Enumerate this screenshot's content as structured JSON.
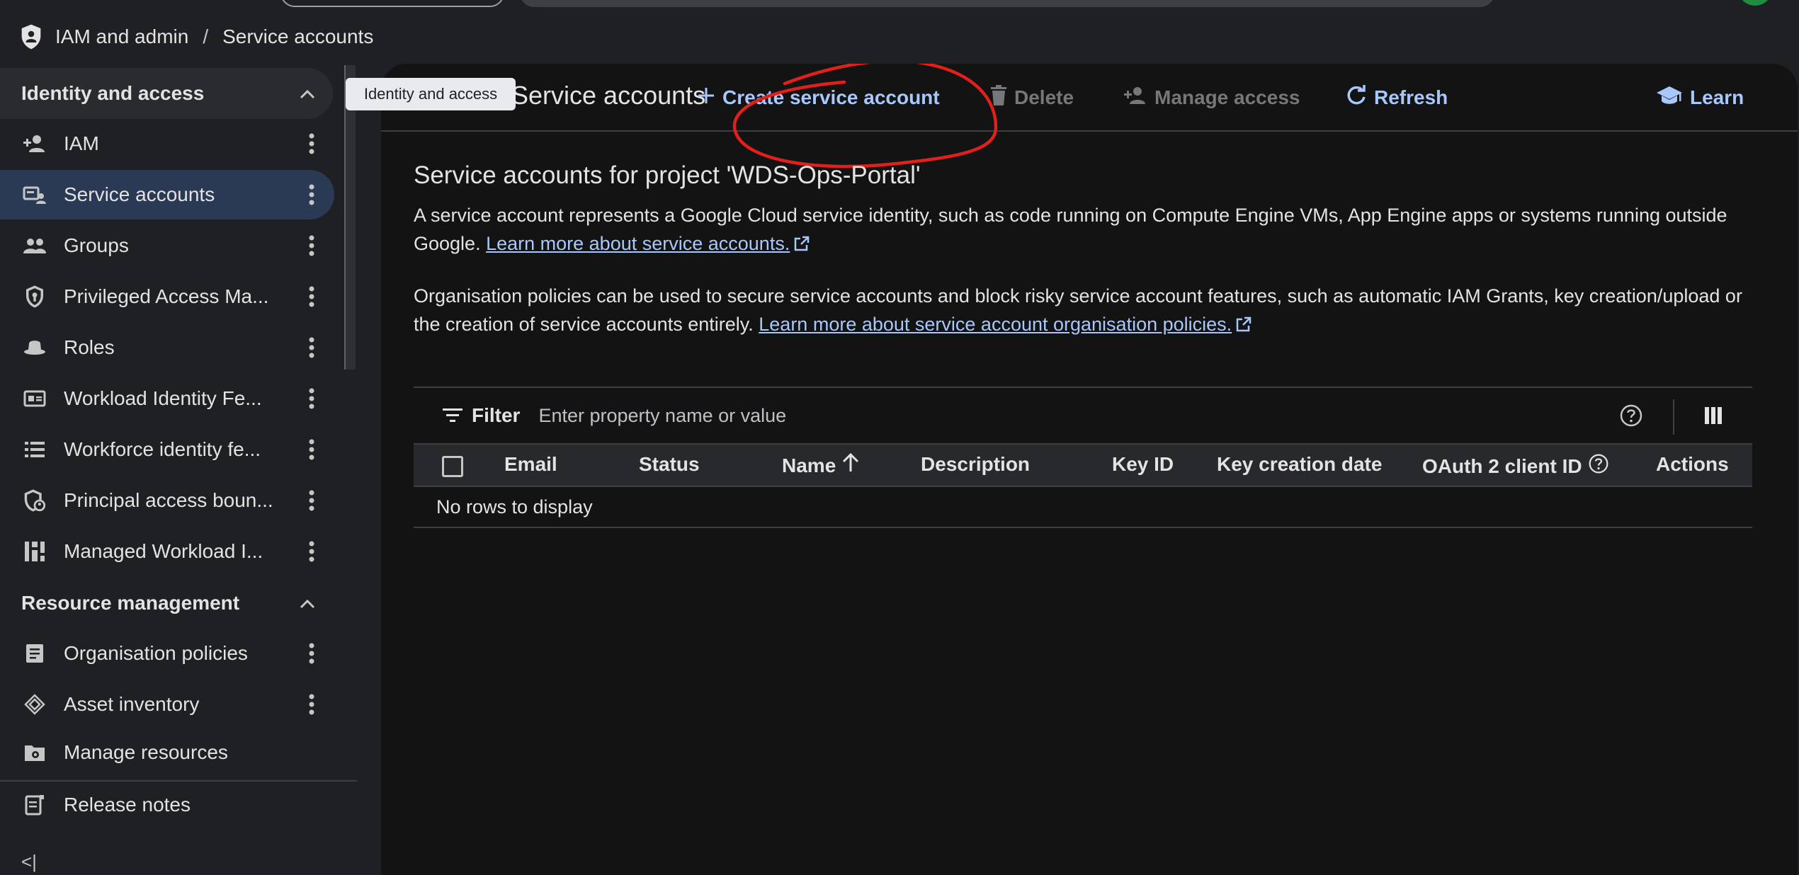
{
  "breadcrumb": {
    "section": "IAM and admin",
    "separator": "/",
    "current": "Service accounts"
  },
  "sidebar": {
    "sections": [
      {
        "label": "Identity and access"
      },
      {
        "label": "Resource management"
      }
    ],
    "items": [
      {
        "label": "IAM",
        "icon": "person-add-icon"
      },
      {
        "label": "Service accounts",
        "icon": "service-account-icon",
        "active": true
      },
      {
        "label": "Groups",
        "icon": "groups-icon"
      },
      {
        "label": "Privileged Access Ma...",
        "icon": "privileged-shield-icon"
      },
      {
        "label": "Roles",
        "icon": "hat-icon"
      },
      {
        "label": "Workload Identity Fe...",
        "icon": "id-card-icon"
      },
      {
        "label": "Workforce identity fe...",
        "icon": "list-icon"
      },
      {
        "label": "Principal access boun...",
        "icon": "shield-person-icon"
      },
      {
        "label": "Managed Workload I...",
        "icon": "dashboard-icon"
      },
      {
        "label": "Organisation policies",
        "icon": "document-icon"
      },
      {
        "label": "Asset inventory",
        "icon": "diamond-icon"
      },
      {
        "label": "Manage resources",
        "icon": "folder-gear-icon"
      },
      {
        "label": "Release notes",
        "icon": "release-notes-icon"
      }
    ],
    "collapse_label": "<|"
  },
  "tooltip": "Identity and access",
  "toolbar": {
    "title": "Service accounts",
    "create": "Create service account",
    "delete": "Delete",
    "manage_access": "Manage access",
    "refresh": "Refresh",
    "learn": "Learn"
  },
  "content": {
    "heading": "Service accounts for project 'WDS-Ops-Portal'",
    "para1": "A service account represents a Google Cloud service identity, such as code running on Compute Engine VMs, App Engine apps or systems running outside Google.",
    "link1": "Learn more about service accounts.",
    "para2": "Organisation policies can be used to secure service accounts and block risky service account features, such as automatic IAM Grants, key creation/upload or the creation of service accounts entirely.",
    "link2": "Learn more about service account organisation policies."
  },
  "table": {
    "filter_label": "Filter",
    "filter_placeholder": "Enter property name or value",
    "columns": [
      "Email",
      "Status",
      "Name",
      "Description",
      "Key ID",
      "Key creation date",
      "OAuth 2 client ID",
      "Actions"
    ],
    "sort_column": "Name",
    "empty_text": "No rows to display"
  },
  "colors": {
    "accent": "#a8c7fa",
    "annotation": "#e0201b",
    "active_nav": "#2a3a55"
  }
}
